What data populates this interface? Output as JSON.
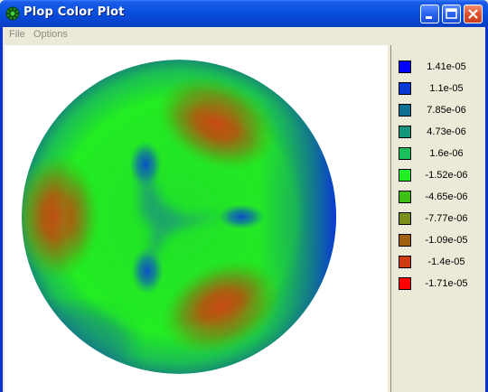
{
  "window": {
    "title": "Plop Color Plot",
    "buttons": [
      "minimize",
      "maximize",
      "close"
    ]
  },
  "menu": [
    "File",
    "Options"
  ],
  "legend": [
    {
      "label": "1.41e-05",
      "color": "#0000ff"
    },
    {
      "label": "1.1e-05",
      "color": "#0a3ad6"
    },
    {
      "label": "7.85e-06",
      "color": "#127094"
    },
    {
      "label": "4.73e-06",
      "color": "#15967a"
    },
    {
      "label": "1.6e-06",
      "color": "#1bc05a"
    },
    {
      "label": "-1.52e-06",
      "color": "#22f022"
    },
    {
      "label": "-4.65e-06",
      "color": "#3ec012"
    },
    {
      "label": "-7.77e-06",
      "color": "#7a901a"
    },
    {
      "label": "-1.09e-05",
      "color": "#a06010"
    },
    {
      "label": "-1.4e-05",
      "color": "#d03c10"
    },
    {
      "label": "-1.71e-05",
      "color": "#ff0000"
    }
  ],
  "icons": {
    "app": "green-gear-icon",
    "minimize": "minimize-icon",
    "maximize": "maximize-icon",
    "close": "close-icon"
  }
}
